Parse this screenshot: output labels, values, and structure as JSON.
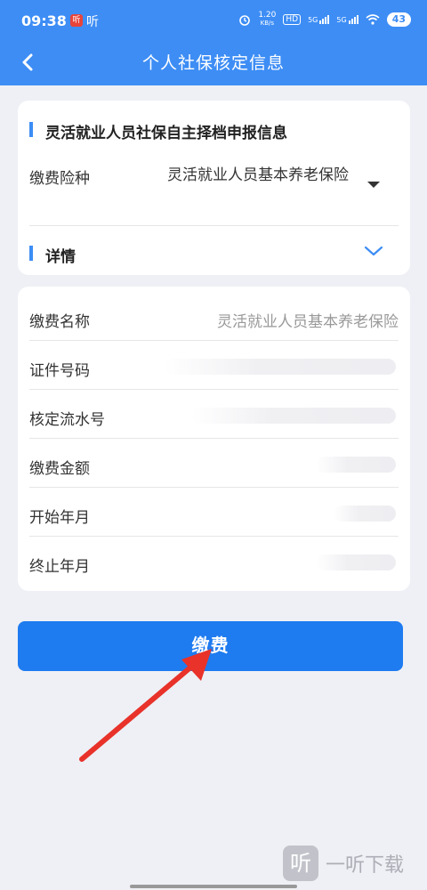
{
  "status_bar": {
    "time": "09:38",
    "app1_badge": "听",
    "app2_label": "听",
    "net_speed_top": "1.20",
    "net_speed_bottom": "KB/s",
    "hd_label": "HD",
    "sig1": "5G",
    "sig2": "5G",
    "battery": "43"
  },
  "nav": {
    "title": "个人社保核定信息"
  },
  "declaration": {
    "section_title": "灵活就业人员社保自主择档申报信息",
    "insurance_label": "缴费险种",
    "insurance_value": "灵活就业人员基本养老保险",
    "details_title": "详情"
  },
  "info_rows": [
    {
      "label": "缴费名称",
      "value": "灵活就业人员基本养老保险"
    },
    {
      "label": "证件号码",
      "value": ""
    },
    {
      "label": "核定流水号",
      "value": ""
    },
    {
      "label": "缴费金额",
      "value": ""
    },
    {
      "label": "开始年月",
      "value": ""
    },
    {
      "label": "终止年月",
      "value": ""
    }
  ],
  "pay_button": {
    "label": "缴费"
  },
  "watermark": {
    "logo": "听",
    "text": "一听下载"
  },
  "colors": {
    "primary": "#3d8df5",
    "button": "#1e7bf0",
    "background": "#eef0f5",
    "arrow": "#e8322a"
  }
}
